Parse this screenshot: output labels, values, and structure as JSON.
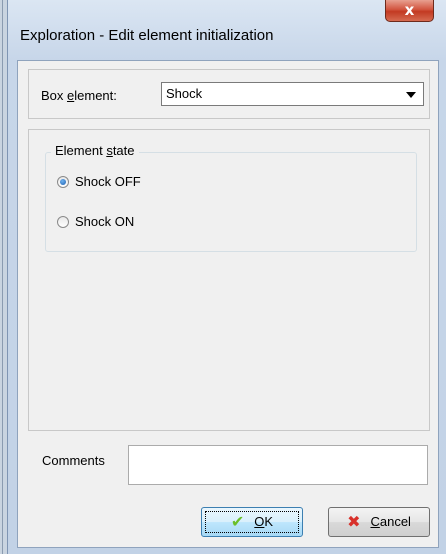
{
  "window": {
    "title": "Exploration - Edit element initialization",
    "close_label": "x"
  },
  "box_element": {
    "label_before": "Box ",
    "label_mnemonic": "e",
    "label_after": "lement:",
    "selected_value": "Shock"
  },
  "element_state": {
    "legend_before": "Element ",
    "legend_mnemonic": "s",
    "legend_after": "tate",
    "options": [
      {
        "label": "Shock OFF",
        "checked": true
      },
      {
        "label": "Shock ON",
        "checked": false
      }
    ]
  },
  "comments": {
    "label": "Comments",
    "value": ""
  },
  "buttons": {
    "ok_mnemonic": "O",
    "ok_rest": "K",
    "cancel_mnemonic": "C",
    "cancel_rest": "ancel"
  },
  "icons": {
    "ok": "check-icon",
    "cancel": "cross-icon"
  },
  "colors": {
    "ok_icon": "#6bbf2a",
    "cancel_icon": "#d8302a",
    "close_button": "#c23a22"
  }
}
